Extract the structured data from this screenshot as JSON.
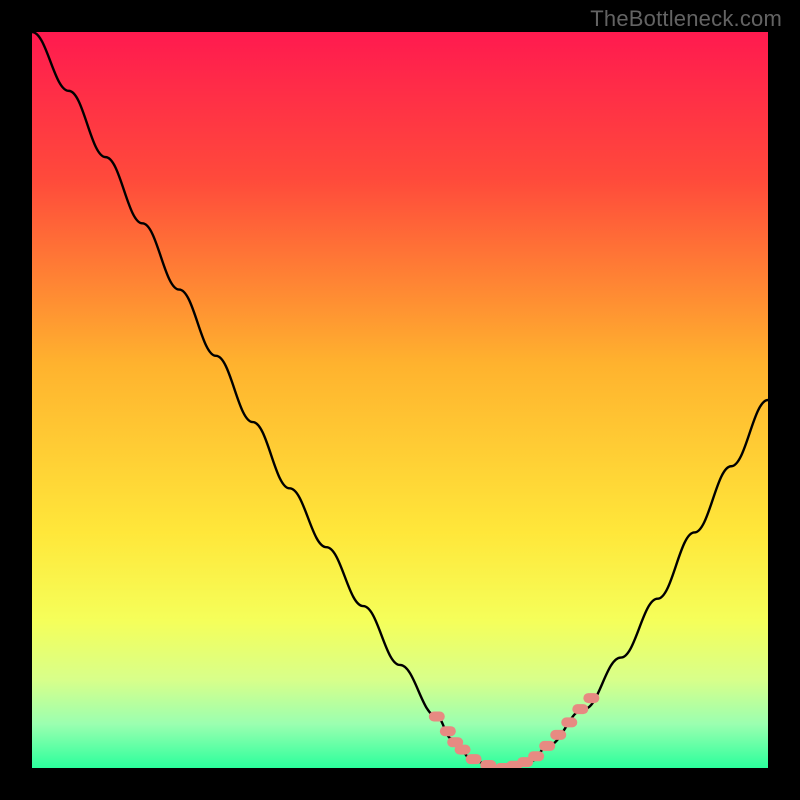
{
  "watermark": "TheBottleneck.com",
  "chart_data": {
    "type": "line",
    "title": "",
    "xlabel": "",
    "ylabel": "",
    "xlim": [
      0,
      100
    ],
    "ylim": [
      0,
      100
    ],
    "series": [
      {
        "name": "bottleneck-curve",
        "x": [
          0,
          5,
          10,
          15,
          20,
          25,
          30,
          35,
          40,
          45,
          50,
          55,
          57,
          60,
          63,
          65,
          68,
          70,
          75,
          80,
          85,
          90,
          95,
          100
        ],
        "y": [
          100,
          92,
          83,
          74,
          65,
          56,
          47,
          38,
          30,
          22,
          14,
          7,
          4,
          1,
          0,
          0,
          1,
          3,
          8,
          15,
          23,
          32,
          41,
          50
        ]
      }
    ],
    "optimal_zone": {
      "name": "salmon-dots",
      "x": [
        55,
        56.5,
        57.5,
        58.5,
        60,
        62,
        64,
        65.5,
        67,
        68.5,
        70,
        71.5,
        73,
        74.5,
        76
      ],
      "y": [
        7,
        5,
        3.5,
        2.5,
        1.2,
        0.4,
        0,
        0.3,
        0.8,
        1.6,
        3,
        4.5,
        6.2,
        8,
        9.5
      ]
    },
    "gradient_stops": [
      {
        "offset": 0,
        "color": "#ff1a4f"
      },
      {
        "offset": 20,
        "color": "#ff4a3b"
      },
      {
        "offset": 45,
        "color": "#ffb22e"
      },
      {
        "offset": 68,
        "color": "#ffe73a"
      },
      {
        "offset": 80,
        "color": "#f5ff5a"
      },
      {
        "offset": 88,
        "color": "#d8ff8a"
      },
      {
        "offset": 94,
        "color": "#9bffb0"
      },
      {
        "offset": 100,
        "color": "#2bff9c"
      }
    ]
  }
}
